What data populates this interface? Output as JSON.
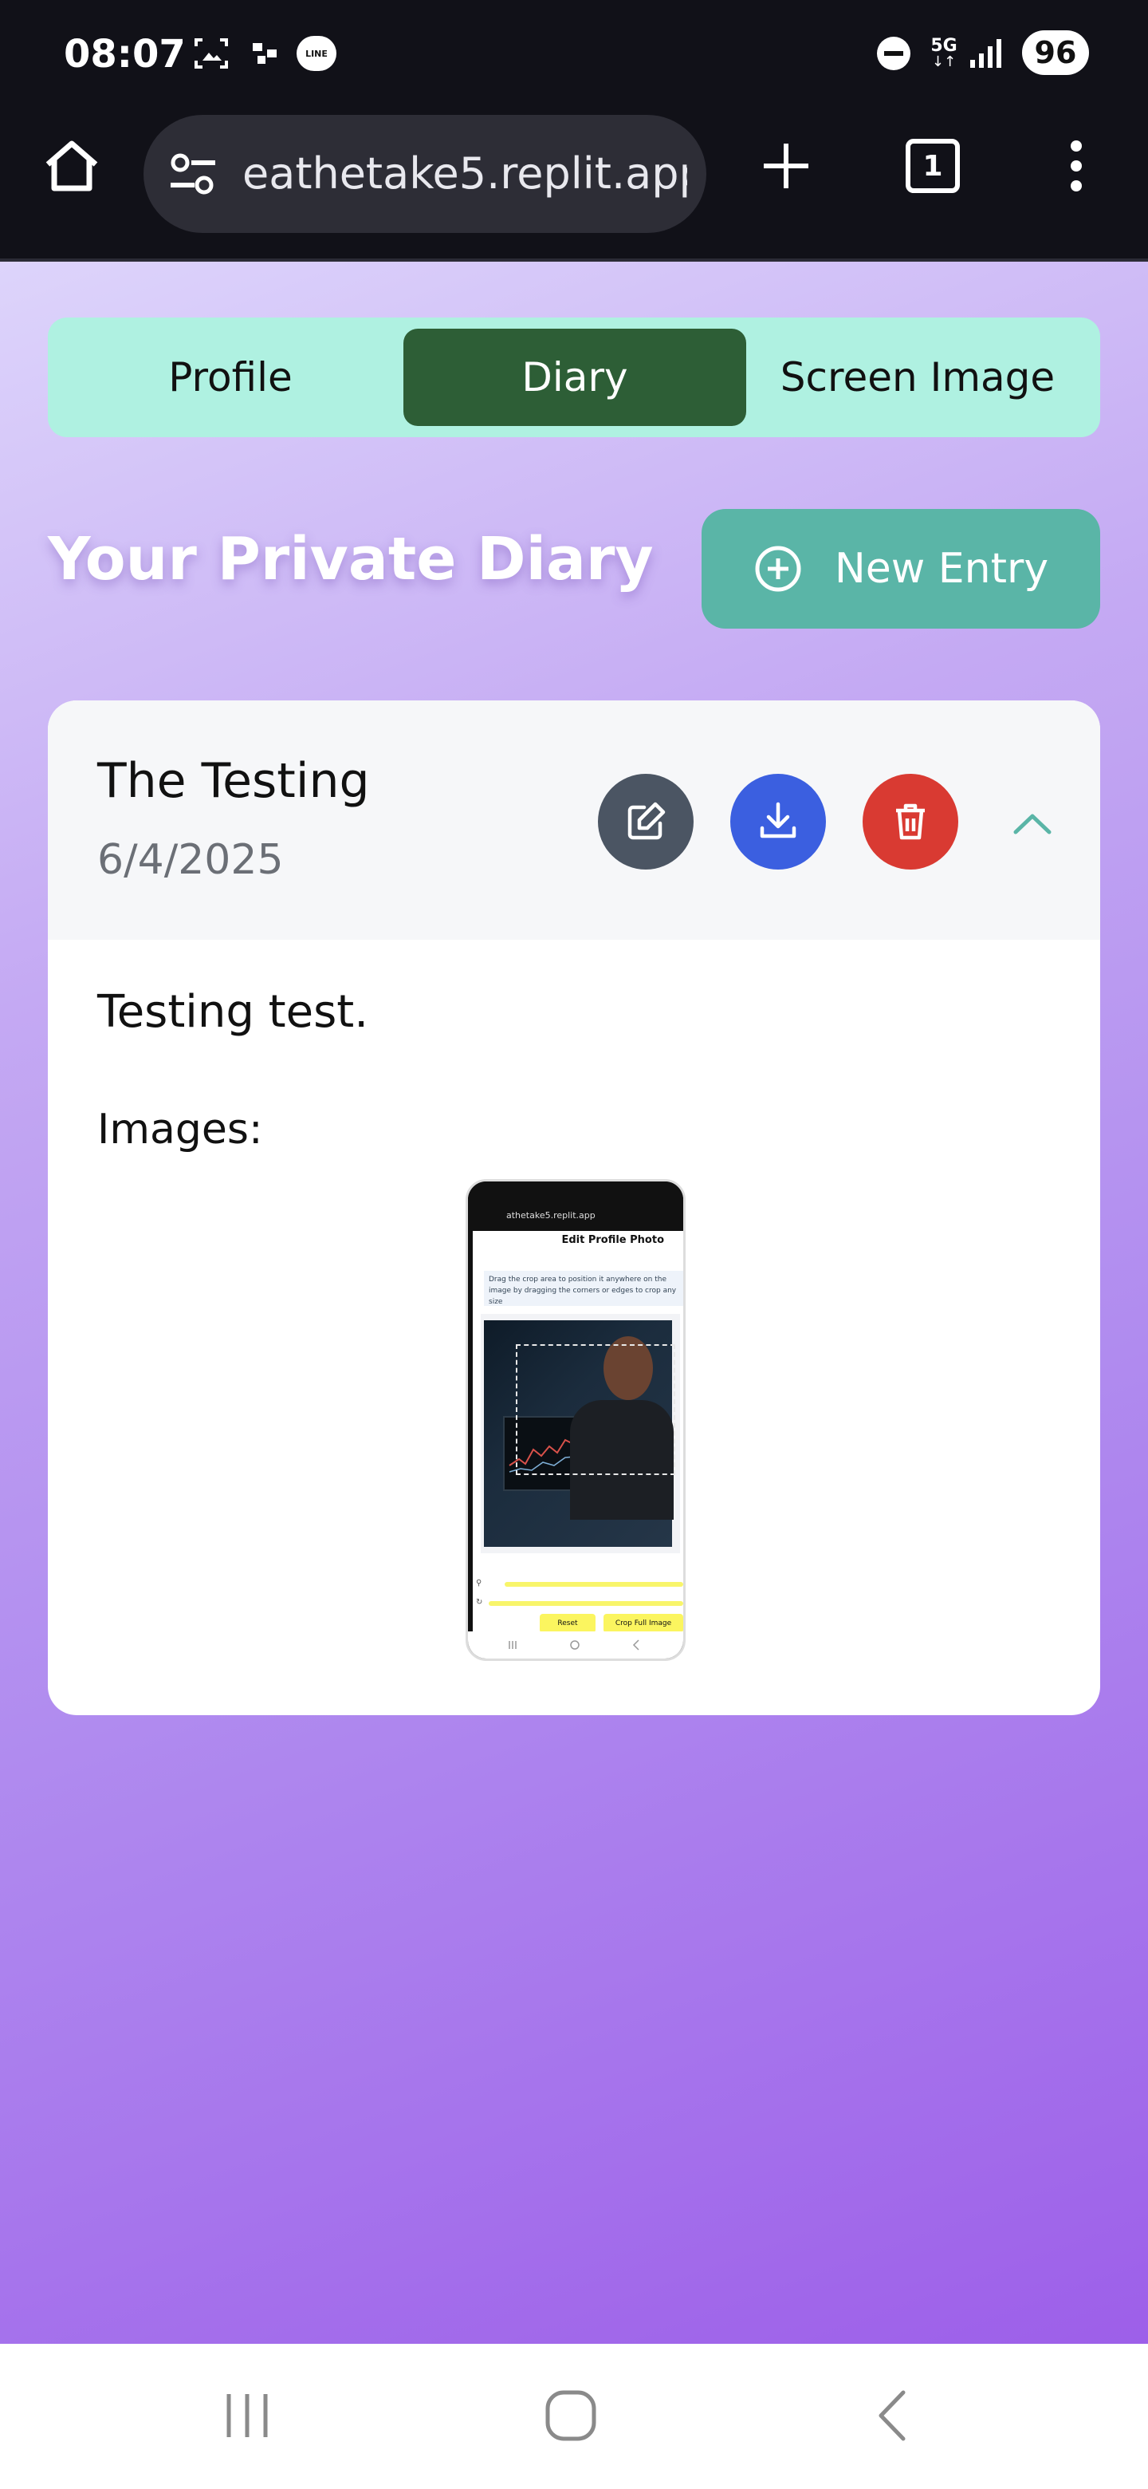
{
  "status_bar": {
    "time": "08:07",
    "network": "5G",
    "battery": "96",
    "line_badge": "LINE"
  },
  "browser": {
    "url": "eathetake5.replit.app",
    "tab_count": "1"
  },
  "tabs": [
    {
      "label": "Profile",
      "active": false
    },
    {
      "label": "Diary",
      "active": true
    },
    {
      "label": "Screen Image",
      "active": false
    }
  ],
  "page": {
    "title": "Your Private Diary",
    "new_entry_label": "New Entry"
  },
  "entry": {
    "title": "The Testing",
    "date": "6/4/2025",
    "body": "Testing test.",
    "images_label": "Images:"
  },
  "thumbnail": {
    "url": "athetake5.replit.app",
    "heading": "Edit Profile Photo",
    "hint": "Drag the crop area to position it anywhere on the image by dragging the corners or edges to crop any size",
    "reset_label": "Reset",
    "crop_full_label": "Crop Full Image"
  },
  "colors": {
    "tab_bar": "#aff1e1",
    "active_tab": "#2d5e36",
    "new_entry": "#5ab5a7",
    "edit_button": "#4b5563",
    "download_button": "#3b5fe0",
    "delete_button": "#d93a32",
    "collapse_chevron": "#5ab5a7"
  }
}
